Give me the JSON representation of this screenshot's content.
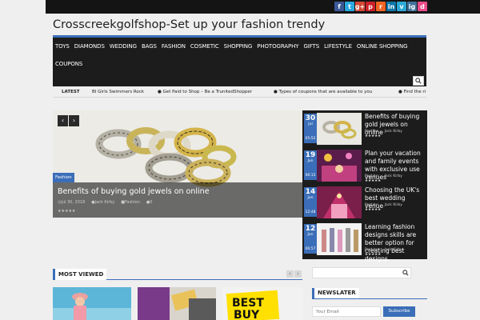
{
  "site": {
    "title": "Crosscreekgolfshop-Set up your fashion trendy"
  },
  "social": [
    {
      "icon": "facebook-icon",
      "glyph": "f",
      "color": "#3b5998"
    },
    {
      "icon": "twitter-icon",
      "glyph": "t",
      "color": "#29a9e1"
    },
    {
      "icon": "google-plus-icon",
      "glyph": "g+",
      "color": "#d34836"
    },
    {
      "icon": "pinterest-icon",
      "glyph": "p",
      "color": "#cb2027"
    },
    {
      "icon": "rss-icon",
      "glyph": "r",
      "color": "#f26522"
    },
    {
      "icon": "linkedin-icon",
      "glyph": "in",
      "color": "#0e76a8"
    },
    {
      "icon": "vimeo-icon",
      "glyph": "v",
      "color": "#2aa9d6"
    },
    {
      "icon": "instagram-icon",
      "glyph": "ig",
      "color": "#3f729b"
    },
    {
      "icon": "dribbble-icon",
      "glyph": "d",
      "color": "#ea4c89"
    }
  ],
  "nav": [
    "TOYS",
    "DIAMONDS",
    "WEDDING",
    "BAGS",
    "FASHION",
    "COSMETIC",
    "SHOPPING",
    "PHOTOGRAPHY",
    "GIFTS",
    "LIFESTYLE",
    "ONLINE SHOPPING",
    "COUPONS"
  ],
  "ticker": {
    "label": "LATEST",
    "items": [
      "BI Girls Swimmers Rock",
      "● Get Paid to Shop – Be a TrunitedShopper",
      "● Types of coupons that are available to you",
      "● Find the ri"
    ]
  },
  "slider": {
    "category": "Fashion",
    "title": "Benefits of buying gold jewels on online",
    "date": "Jul 30, 2018",
    "author": "Jack Kirby",
    "category_meta": "Fashion",
    "comments": "0",
    "rating": 5,
    "prev": "‹",
    "next": "›"
  },
  "posts": [
    {
      "day": "30",
      "month": "Jul",
      "time": "05:52",
      "title": "Benefits of buying gold jewels on online",
      "by_label": "Post by:",
      "author": "Jack Kirby",
      "rating": 5
    },
    {
      "day": "19",
      "month": "Jun",
      "time": "06:15",
      "title": "Plan your vacation and family events with exclusive use venues",
      "by_label": "Post by:",
      "author": "Jack Kirby",
      "rating": 5
    },
    {
      "day": "14",
      "month": "Jun",
      "time": "12:48",
      "title": "Choosing the UK's best wedding venue",
      "by_label": "Post by:",
      "author": "Jack Kirby",
      "rating": 5
    },
    {
      "day": "12",
      "month": "Jun",
      "time": "06:57",
      "title": "Learning fashion designs skills are better option for creating best designs",
      "by_label": "Post by:",
      "author": "Jack Kirby",
      "rating": 5
    }
  ],
  "most_viewed": {
    "title": "MOST VIEWED",
    "prev": "‹",
    "next": "›"
  },
  "sidebar": {
    "newsletter_title": "NEWSLATER",
    "email_placeholder": "Your Email",
    "subscribe": "Subscribe"
  },
  "colors": {
    "accent": "#3b6eb8",
    "nav_bg": "#1c1c1c",
    "page_bg": "#efefef"
  }
}
